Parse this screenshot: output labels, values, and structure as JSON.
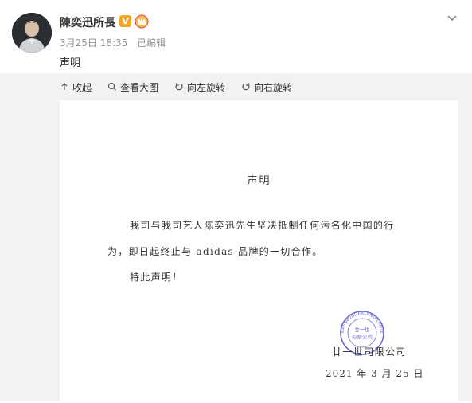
{
  "post": {
    "author_name": "陳奕迅所長",
    "verified_badge": "V",
    "icons": {
      "badge": "crown-badge-icon",
      "more": "chevron-down-icon"
    },
    "timestamp": "3月25日 18:35",
    "edited_label": "已编辑",
    "text": "声明"
  },
  "toolbar": {
    "collapse": "收起",
    "view_large": "查看大图",
    "rotate_left": "向左旋转",
    "rotate_right": "向右旋转"
  },
  "document": {
    "title": "声明",
    "paragraph_line1": "我司与我司艺人陈奕迅先生坚决抵制任何污名化中国的行",
    "paragraph_line2": "为，即日起终止与 adidas 品牌的一切合作。",
    "closing": "特此声明！",
    "company": "廿一世司限公司",
    "date": "2021 年 3 月 25 日",
    "stamp_center_text": "廿一世有限公司",
    "stamp_ring_text": "EAS WONDERLAND LIMITED"
  },
  "colors": {
    "accent": "#f5a623",
    "stamp": "#6b6bd6",
    "viewer_bg": "#f2f2f5",
    "meta_text": "#939393"
  }
}
